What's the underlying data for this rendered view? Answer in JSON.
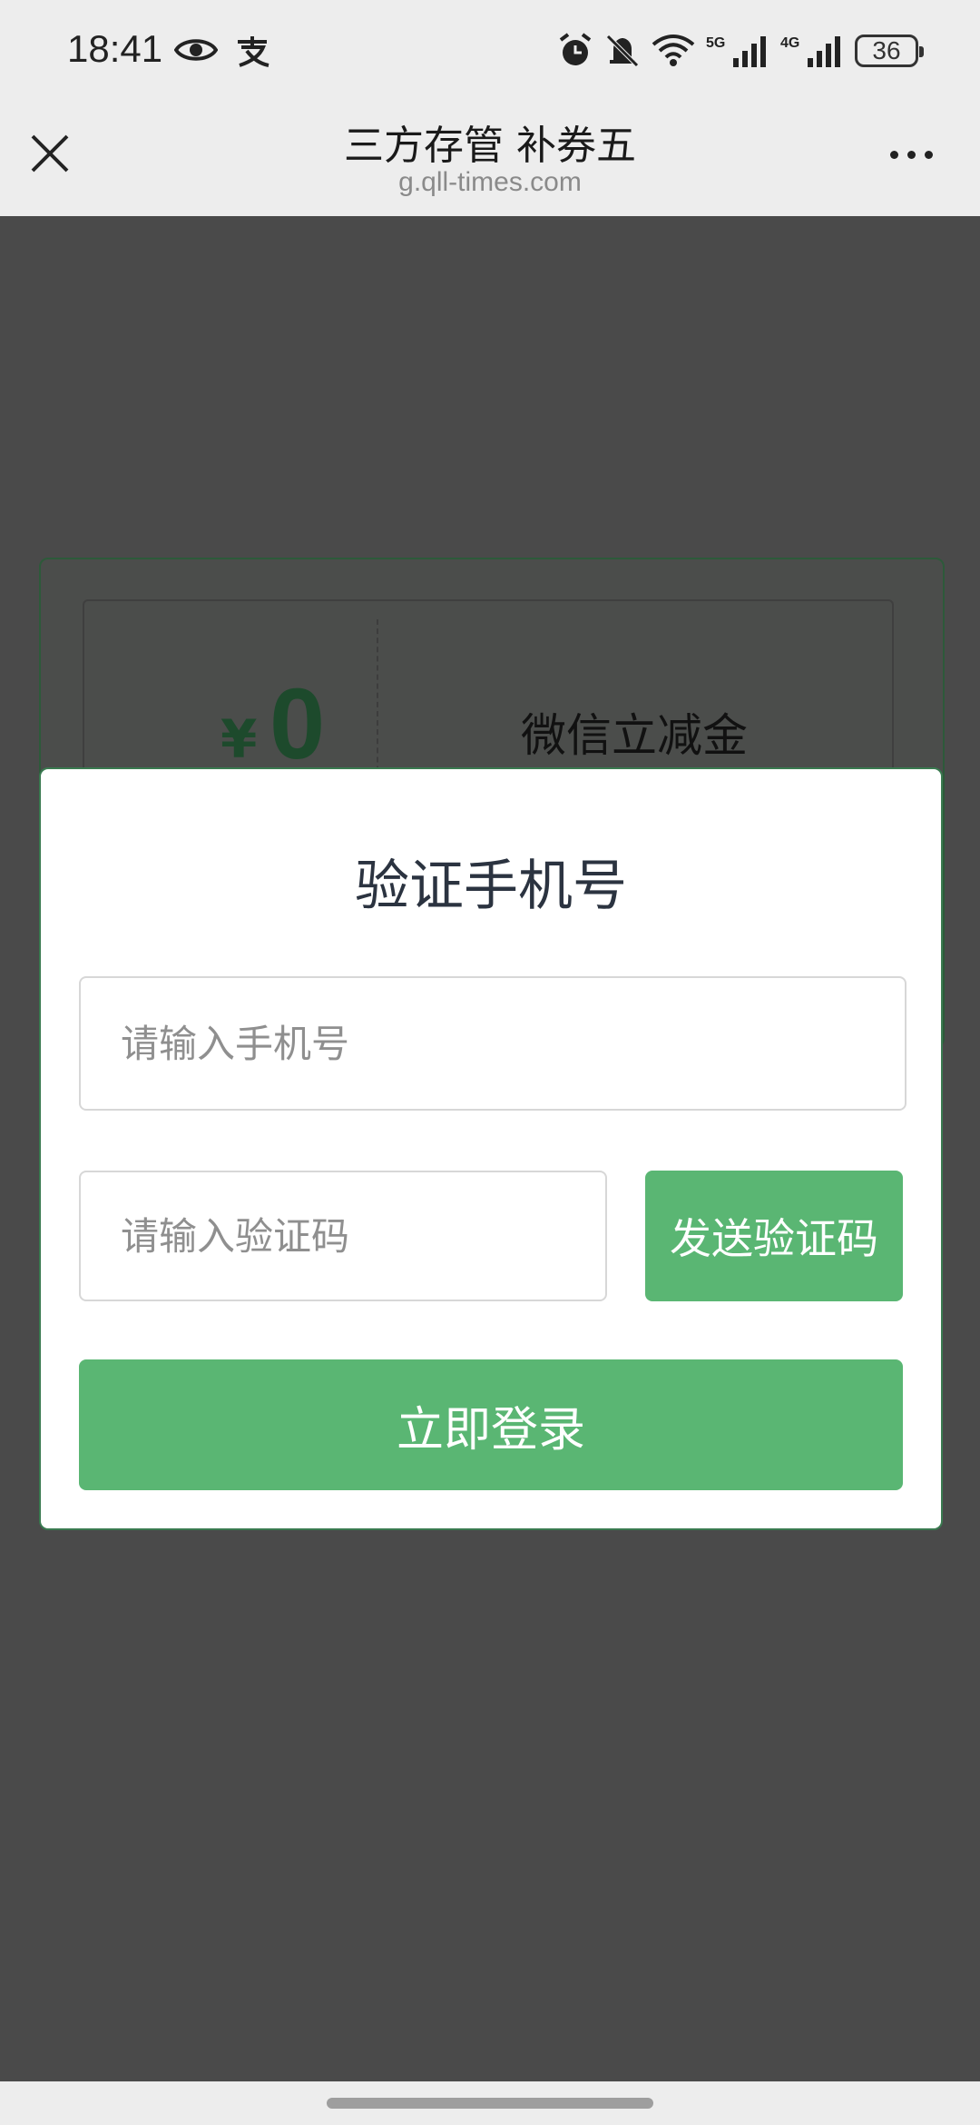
{
  "status_bar": {
    "time": "18:41",
    "battery": "36",
    "icons_left": [
      "eye-icon",
      "alipay-icon"
    ],
    "icons_right": [
      "alarm-icon",
      "bell-off-icon",
      "wifi-icon",
      "5g-signal-icon",
      "4g-signal-icon",
      "battery-icon"
    ]
  },
  "nav": {
    "title": "三方存管 补券五",
    "url": "g.qll-times.com",
    "close_icon": "close-icon",
    "more_icon": "more-icon"
  },
  "coupon": {
    "currency": "¥",
    "amount": "0",
    "name": "微信立减金"
  },
  "modal": {
    "title": "验证手机号",
    "phone_placeholder": "请输入手机号",
    "phone_value": "",
    "code_placeholder": "请输入验证码",
    "code_value": "",
    "send_code_label": "发送验证码",
    "login_label": "立即登录"
  },
  "colors": {
    "primary_green": "#5ab673",
    "overlay": "#4a4a4a",
    "title_text": "#2b3340"
  }
}
